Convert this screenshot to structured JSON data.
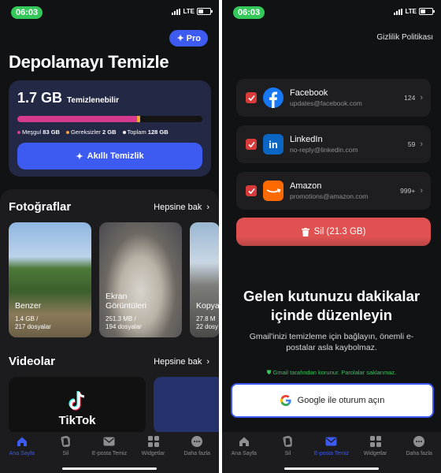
{
  "status": {
    "time": "06:03",
    "network": "LTE"
  },
  "left": {
    "pro_label": "Pro",
    "title": "Depolamayı Temizle",
    "storage": {
      "cleanable_value": "1.7 GB",
      "cleanable_label": "Temizlenebilir",
      "used_fraction": 0.648,
      "unnecessary_fraction": 0.016,
      "legend": [
        {
          "label": "Meşgul",
          "value": "83 GB",
          "color": "#d63a8f"
        },
        {
          "label": "Gereksizler",
          "value": "2 GB",
          "color": "#f0a43a"
        },
        {
          "label": "Toplam",
          "value": "128 GB",
          "color": "#ffffff"
        }
      ],
      "smart_clean": "Akıllı Temizlik"
    },
    "photos": {
      "title": "Fotoğraflar",
      "see_all": "Hepsine bak",
      "items": [
        {
          "name": "Benzer",
          "size": "1.4 GB /",
          "count": "217 dosyalar"
        },
        {
          "name": "Ekran\nGörüntüleri",
          "size": "251.3 MB /",
          "count": "194 dosyalar"
        },
        {
          "name": "Kopya",
          "size": "27.8 M",
          "count": "22 dosy"
        }
      ]
    },
    "videos": {
      "title": "Videolar",
      "see_all": "Hepsine bak",
      "tiktok": "TikTok"
    }
  },
  "tabs": [
    {
      "label": "Ana Sayfa",
      "icon": "home-icon"
    },
    {
      "label": "Sil",
      "icon": "cards-icon"
    },
    {
      "label": "E-posta Temiz",
      "icon": "mail-icon"
    },
    {
      "label": "Widgetlar",
      "icon": "grid-icon"
    },
    {
      "label": "Daha fazla",
      "icon": "more-icon"
    }
  ],
  "right": {
    "privacy": "Gizlilik Politikası",
    "senders": [
      {
        "name": "Facebook",
        "email": "updates@facebook.com",
        "count": "124",
        "color": "#1877f2"
      },
      {
        "name": "LinkedIn",
        "email": "no-reply@linkedin.com",
        "count": "59",
        "color": "#0a66c2"
      },
      {
        "name": "Amazon",
        "email": "promotions@amazon.com",
        "count": "999+",
        "color": "#ff6a00"
      }
    ],
    "delete_label": "Sil (21.3 GB)",
    "hero_title": "Gelen kutunuzu dakikalar içinde düzenleyin",
    "hero_sub": "Gmail'inizi temizleme için bağlayın, önemli e-postalar asla kaybolmaz.",
    "protect_note": "Gmail tarafından korunur. Parolalar saklanmaz.",
    "google_btn": "Google ile oturum açın"
  }
}
